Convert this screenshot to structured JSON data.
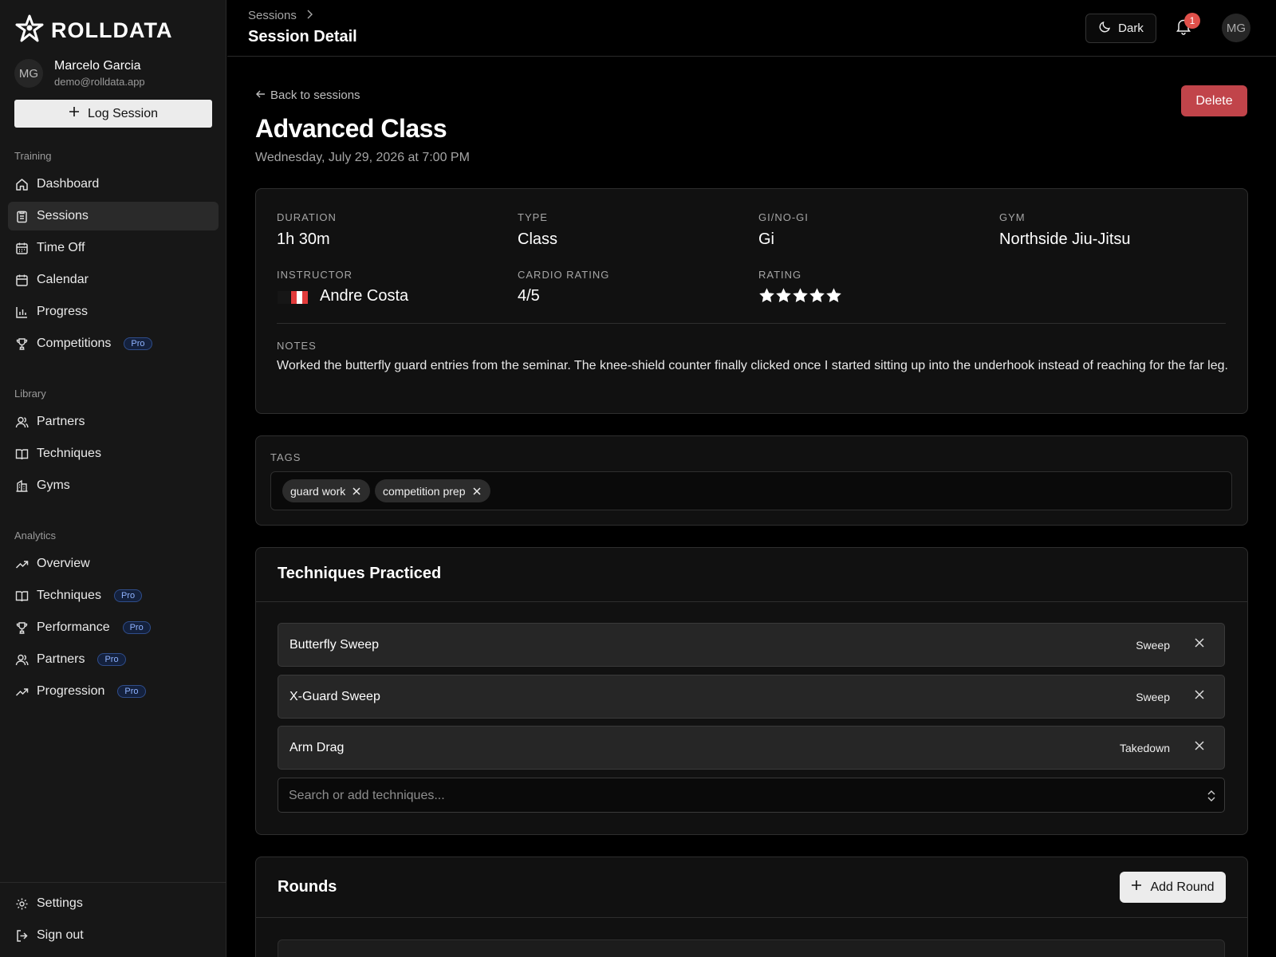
{
  "app": {
    "name": "ROLLDATA"
  },
  "user": {
    "initials": "MG",
    "name": "Marcelo Garcia",
    "email": "demo@rolldata.app"
  },
  "sidebar": {
    "log_session_label": "Log Session",
    "training_label": "Training",
    "training": [
      {
        "label": "Dashboard",
        "icon": "home-icon"
      },
      {
        "label": "Sessions",
        "icon": "clipboard-icon",
        "active": true
      },
      {
        "label": "Time Off",
        "icon": "calendar-off-icon"
      },
      {
        "label": "Calendar",
        "icon": "calendar-icon"
      },
      {
        "label": "Progress",
        "icon": "bar-chart-icon"
      },
      {
        "label": "Competitions",
        "icon": "trophy-icon",
        "pro": "Pro"
      }
    ],
    "library_label": "Library",
    "library": [
      {
        "label": "Partners",
        "icon": "users-icon"
      },
      {
        "label": "Techniques",
        "icon": "book-icon"
      },
      {
        "label": "Gyms",
        "icon": "building-icon"
      }
    ],
    "analytics_label": "Analytics",
    "analytics": [
      {
        "label": "Overview",
        "icon": "trending-up-icon"
      },
      {
        "label": "Techniques",
        "icon": "book-icon",
        "pro": "Pro"
      },
      {
        "label": "Performance",
        "icon": "trophy-icon",
        "pro": "Pro"
      },
      {
        "label": "Partners",
        "icon": "users-icon",
        "pro": "Pro"
      },
      {
        "label": "Progression",
        "icon": "trending-up-icon",
        "pro": "Pro"
      }
    ],
    "settings_label": "Settings",
    "signout_label": "Sign out"
  },
  "header": {
    "breadcrumb_parent": "Sessions",
    "page_title": "Session Detail",
    "theme_label": "Dark",
    "notification_count": "1",
    "avatar_initials": "MG"
  },
  "session": {
    "back_label": "Back to sessions",
    "title": "Advanced Class",
    "datetime": "Wednesday, July 29, 2026 at 7:00 PM",
    "delete_label": "Delete",
    "duration_label": "DURATION",
    "duration": "1h 30m",
    "type_label": "TYPE",
    "type": "Class",
    "gi_label": "GI/NO-GI",
    "gi": "Gi",
    "gym_label": "GYM",
    "gym": "Northside Jiu-Jitsu",
    "instructor_label": "INSTRUCTOR",
    "instructor": "Andre Costa",
    "cardio_label": "CARDIO RATING",
    "cardio": "4/5",
    "rating_label": "RATING",
    "rating": 5,
    "rating_max": 5,
    "notes_label": "NOTES",
    "notes": "Worked the butterfly guard entries from the seminar. The knee-shield counter finally clicked once I started sitting up into the underhook instead of reaching for the far leg."
  },
  "tags": {
    "label": "TAGS",
    "items": [
      "guard work",
      "competition prep"
    ]
  },
  "techniques": {
    "title": "Techniques Practiced",
    "items": [
      {
        "name": "Butterfly Sweep",
        "category": "Sweep"
      },
      {
        "name": "X-Guard Sweep",
        "category": "Sweep"
      },
      {
        "name": "Arm Drag",
        "category": "Takedown"
      }
    ],
    "search_placeholder": "Search or add techniques..."
  },
  "rounds": {
    "title": "Rounds",
    "add_label": "Add Round"
  },
  "colors": {
    "accent_delete": "#c1444a",
    "badge": "#e0504a",
    "pro": "#8fb3ff"
  }
}
